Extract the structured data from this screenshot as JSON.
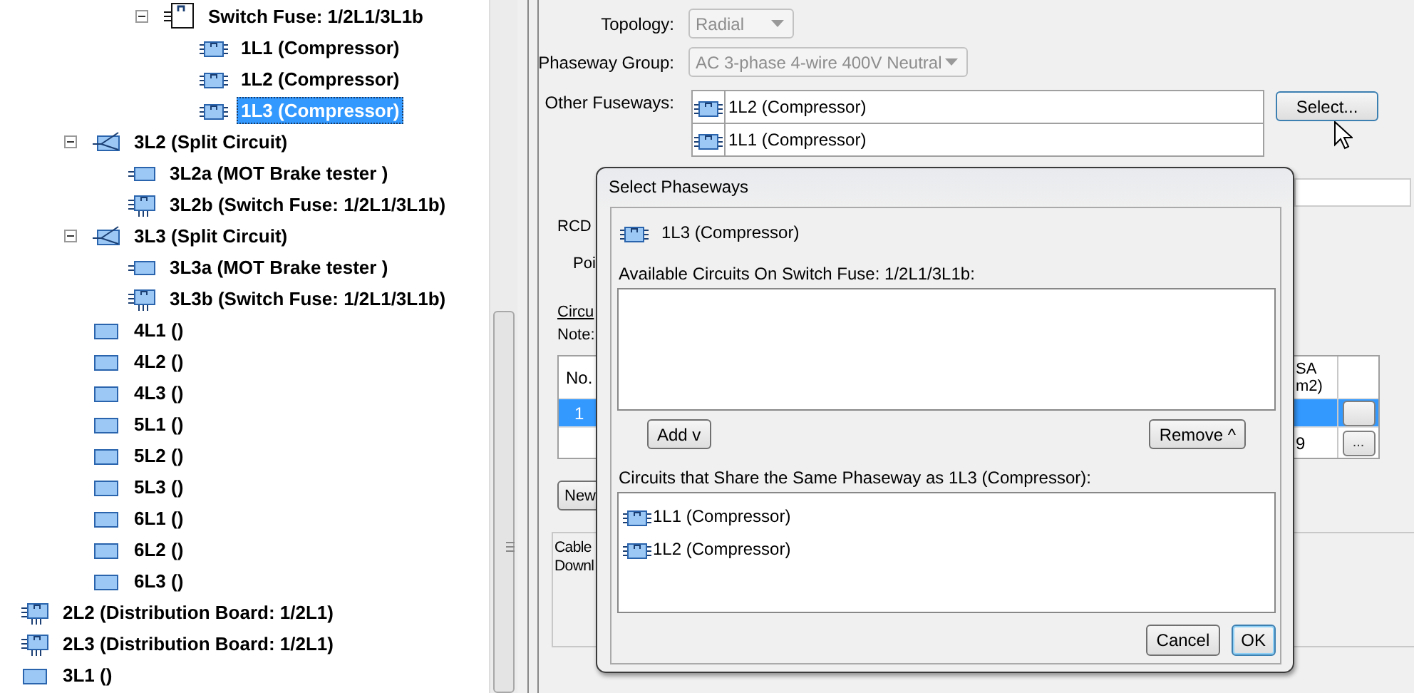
{
  "tree": {
    "items": [
      {
        "children": [
          {
            "children": [
              {
                "children": [
                  {
                    "children": [
                      {
                        "label": "Switch Fuse: 1/2L1/3L1b",
                        "kind": "switch",
                        "expanded": true,
                        "selected": false,
                        "children": [
                          {
                            "label": "1L1 (Compressor)",
                            "kind": "circuit",
                            "selected": false
                          },
                          {
                            "label": "1L2 (Compressor)",
                            "kind": "circuit",
                            "selected": false
                          },
                          {
                            "label": "1L3 (Compressor)",
                            "kind": "circuit",
                            "selected": true
                          }
                        ]
                      }
                    ]
                  }
                ]
              },
              {
                "label": "3L2 (Split Circuit)",
                "kind": "split",
                "expanded": true,
                "selected": false,
                "children": [
                  {
                    "label": "3L2a (MOT Brake tester )",
                    "kind": "load",
                    "selected": false
                  },
                  {
                    "label": "3L2b (Switch Fuse: 1/2L1/3L1b)",
                    "kind": "board",
                    "selected": false
                  }
                ]
              },
              {
                "label": "3L3 (Split Circuit)",
                "kind": "split",
                "expanded": true,
                "selected": false,
                "children": [
                  {
                    "label": "3L3a (MOT Brake tester )",
                    "kind": "load",
                    "selected": false
                  },
                  {
                    "label": "3L3b (Switch Fuse: 1/2L1/3L1b)",
                    "kind": "board",
                    "selected": false
                  }
                ]
              },
              {
                "label": "4L1 ()",
                "kind": "way",
                "selected": false
              },
              {
                "label": "4L2 ()",
                "kind": "way",
                "selected": false
              },
              {
                "label": "4L3 ()",
                "kind": "way",
                "selected": false
              },
              {
                "label": "5L1 ()",
                "kind": "way",
                "selected": false
              },
              {
                "label": "5L2 ()",
                "kind": "way",
                "selected": false
              },
              {
                "label": "5L3 ()",
                "kind": "way",
                "selected": false
              },
              {
                "label": "6L1 ()",
                "kind": "way",
                "selected": false
              },
              {
                "label": "6L2 ()",
                "kind": "way",
                "selected": false
              },
              {
                "label": "6L3 ()",
                "kind": "way",
                "selected": false
              }
            ]
          }
        ]
      },
      {
        "label": "2L2 (Distribution Board: 1/2L1)",
        "kind": "board",
        "selected": false
      },
      {
        "label": "2L3 (Distribution Board: 1/2L1)",
        "kind": "board",
        "selected": false
      },
      {
        "label": "3L1 ()",
        "kind": "way",
        "selected": false
      }
    ]
  },
  "details": {
    "topology": {
      "label": "Topology:",
      "value": "Radial",
      "disabled": true
    },
    "phaseway_group": {
      "label": "Phaseway Group:",
      "value": "AC 3-phase 4-wire 400V Neutral",
      "disabled": true
    },
    "other_fuseways": {
      "label": "Other Fuseways:",
      "items": [
        {
          "label": "1L2 (Compressor)"
        },
        {
          "label": "1L1 (Compressor)"
        }
      ],
      "button": "Select..."
    },
    "rcd_label": "RCD",
    "poi_label": "Poi",
    "circuits_heading": "Circu",
    "note_label": "Note:",
    "table": {
      "columns": [
        "No.",
        "SA\nm2)"
      ],
      "rows": [
        {
          "selected": true,
          "no": "1"
        },
        {
          "selected": false,
          "column_3": "9",
          "button": "..."
        }
      ]
    },
    "new_button": "New",
    "cable_lines": [
      "Cable",
      "Downl"
    ]
  },
  "dialog": {
    "title": "Select Phaseways",
    "circuit": "1L3 (Compressor)",
    "available_label": "Available Circuits On Switch Fuse: 1/2L1/3L1b:",
    "add_button": "Add v",
    "remove_button": "Remove ^",
    "shared_label": "Circuits that Share the Same Phaseway as 1L3 (Compressor):",
    "shared": [
      {
        "label": "1L1 (Compressor)"
      },
      {
        "label": "1L2 (Compressor)"
      }
    ],
    "buttons": [
      {
        "label": "Cancel",
        "default": false
      },
      {
        "label": "OK",
        "default": true
      }
    ]
  }
}
